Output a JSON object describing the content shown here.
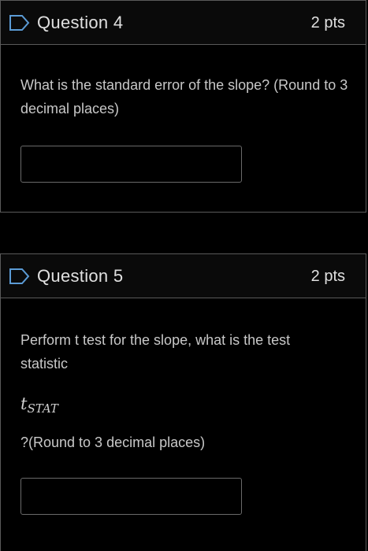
{
  "questions": [
    {
      "title": "Question 4",
      "points": "2 pts",
      "prompt": "What is the standard error of the slope? (Round to 3 decimal places)",
      "answer": ""
    },
    {
      "title": "Question 5",
      "points": "2 pts",
      "prompt": "Perform t test for the slope, what is the test statistic",
      "math_symbol": "t",
      "math_subscript": "STAT",
      "prompt_after": "?(Round to 3 decimal places)",
      "answer": ""
    }
  ],
  "colors": {
    "background": "#000000",
    "border": "#5a5a5a",
    "flag_outline": "#5b9bd5"
  },
  "icons": {
    "flag": "question-flag-icon"
  }
}
